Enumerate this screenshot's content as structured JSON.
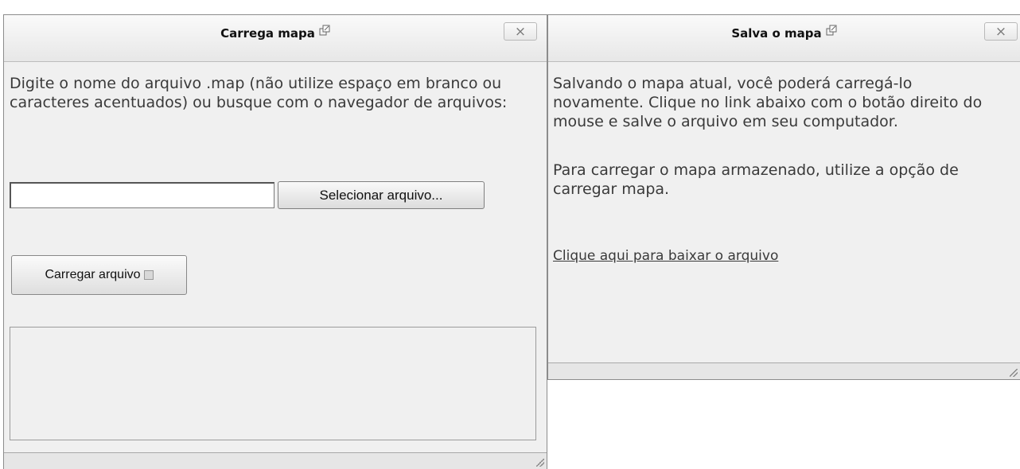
{
  "load_dialog": {
    "title": "Carrega mapa",
    "title_icon": "external-link-icon",
    "close_label": "×",
    "instructions": "Digite o nome do arquivo .map (não utilize espaço em branco ou caracteres acentuados) ou busque com o navegador de arquivos:",
    "file_input_value": "",
    "select_button_label": "Selecionar arquivo...",
    "load_button_label": "Carregar arquivo",
    "output_text": ""
  },
  "save_dialog": {
    "title": "Salva o mapa",
    "title_icon": "external-link-icon",
    "close_label": "×",
    "paragraph1": "Salvando o mapa atual, você poderá carregá-lo novamente. Clique no link abaixo com o botão direito do mouse e salve o arquivo em seu computador.",
    "paragraph2": "Para carregar o mapa armazenado, utilize a opção de carregar mapa.",
    "download_link": "Clique aqui para baixar o arquivo"
  }
}
